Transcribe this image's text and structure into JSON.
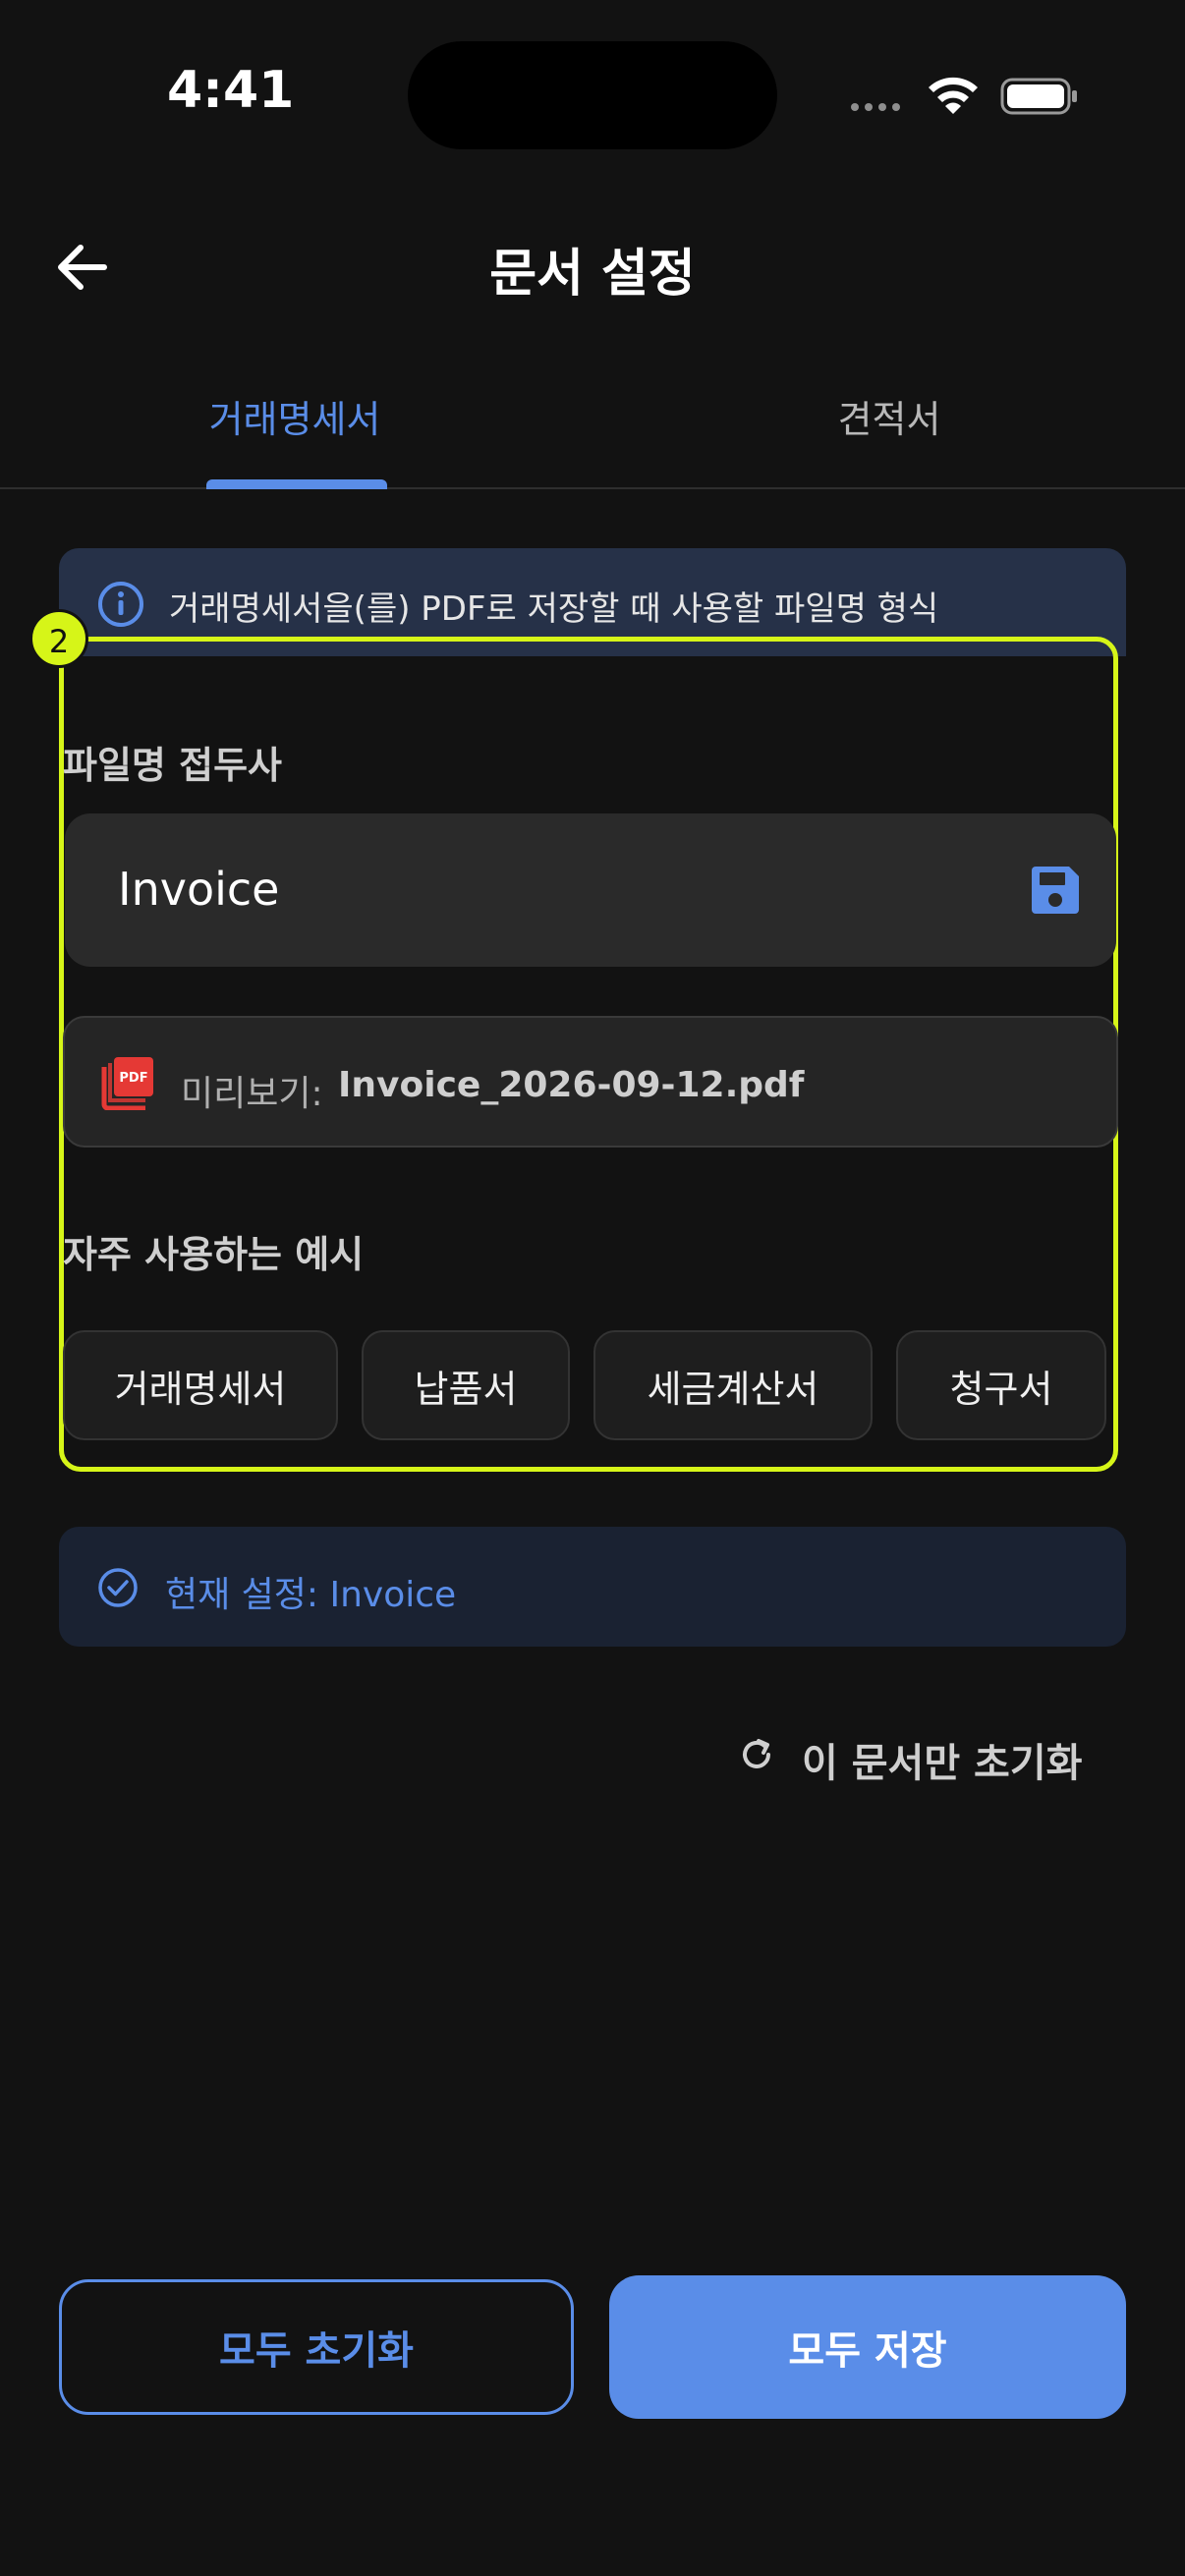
{
  "status_bar": {
    "time": "4:41"
  },
  "app_bar": {
    "title": "문서 설정"
  },
  "tabs": [
    {
      "label": "거래명세서",
      "active": true
    },
    {
      "label": "견적서",
      "active": false
    }
  ],
  "info_banner": {
    "text": "거래명세서을(를) PDF로 저장할 때 사용할 파일명 형식"
  },
  "highlight": {
    "badge": "2"
  },
  "prefix_section": {
    "label": "파일명 접두사",
    "value": "Invoice",
    "preview_label": "미리보기:",
    "preview_value": "Invoice_2026-09-12.pdf"
  },
  "examples": {
    "label": "자주 사용하는 예시",
    "chips": [
      "거래명세서",
      "납품서",
      "세금계산서",
      "청구서"
    ]
  },
  "current_setting": {
    "text": "현재 설정: Invoice"
  },
  "reset_doc": {
    "label": "이 문서만 초기화"
  },
  "bottom": {
    "reset_all": "모두 초기화",
    "save_all": "모두 저장"
  },
  "colors": {
    "accent": "#5a8de8",
    "highlight": "#d6f518",
    "pdf": "#e53935"
  }
}
